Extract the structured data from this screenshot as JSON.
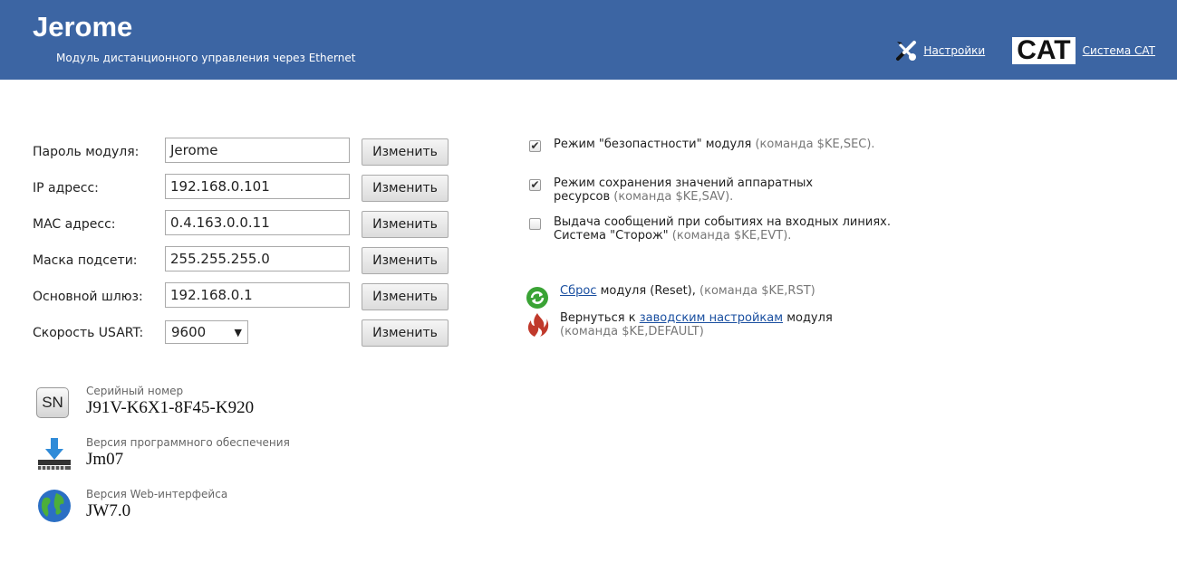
{
  "header": {
    "title": "Jerome",
    "subtitle": "Модуль дистанционного управления через Ethernet",
    "settings_link": "Настройки",
    "cat_logo": "CAT",
    "cat_link": "Система CAT"
  },
  "form": {
    "rows": [
      {
        "label": "Пароль модуля:",
        "value": "Jerome",
        "button": "Изменить"
      },
      {
        "label": "IP адресс:",
        "value": "192.168.0.101",
        "button": "Изменить"
      },
      {
        "label": "MAC адресс:",
        "value": "0.4.163.0.0.11",
        "button": "Изменить"
      },
      {
        "label": "Маска подсети:",
        "value": "255.255.255.0",
        "button": "Изменить"
      },
      {
        "label": "Основной шлюз:",
        "value": "192.168.0.1",
        "button": "Изменить"
      }
    ],
    "usart": {
      "label": "Скорость USART:",
      "value": "9600",
      "button": "Изменить"
    }
  },
  "options": [
    {
      "checked": true,
      "text": "Режим \"безопастности\" модуля",
      "cmd": "(команда $KE,SEC)."
    },
    {
      "checked": true,
      "text": "Режим сохранения значений аппаратных ресурсов",
      "cmd": "(команда $KE,SAV)."
    },
    {
      "checked": false,
      "text": "Выдача сообщений при событиях на входных линиях. Система \"Сторож\"",
      "cmd": "(команда $KE,EVT)."
    }
  ],
  "actions": {
    "reset": {
      "link": "Сброс",
      "text": "модуля (Reset),",
      "cmd": "(команда $KE,RST)"
    },
    "factory": {
      "prefix": "Вернуться к",
      "link": "заводским настройкам",
      "suffix": "модуля",
      "cmd": "(команда $KE,DEFAULT)"
    }
  },
  "info": {
    "serial": {
      "icon": "SN",
      "caption": "Серийный номер",
      "value": "J91V-K6X1-8F45-K920"
    },
    "firmware": {
      "caption": "Версия программного обеспечения",
      "value": "Jm07"
    },
    "web": {
      "caption": "Версия Web-интерфейса",
      "value": "JW7.0"
    }
  }
}
